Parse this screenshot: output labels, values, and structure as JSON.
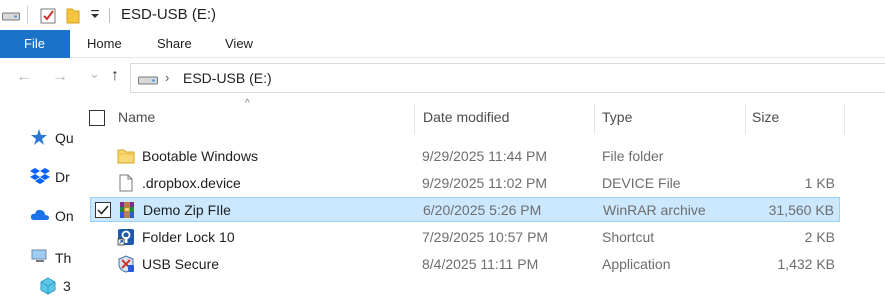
{
  "window": {
    "title": "ESD-USB (E:)",
    "quick_access_icons": [
      "drive-icon",
      "properties-check-icon",
      "new-folder-icon",
      "customize-dropdown-icon"
    ]
  },
  "ribbon": {
    "tabs": [
      {
        "label": "File",
        "active": true
      },
      {
        "label": "Home"
      },
      {
        "label": "Share"
      },
      {
        "label": "View"
      }
    ],
    "accent_color": "#1a73c8"
  },
  "nav": {
    "back_icon": "←",
    "forward_icon": "→",
    "recent_icon": "⌄",
    "up_icon": "↑",
    "breadcrumb": [
      "ESD-USB (E:)"
    ]
  },
  "left_pane": {
    "items": [
      {
        "label": "Qu",
        "icon": "star-icon"
      },
      {
        "label": "Dr",
        "icon": "dropbox-icon"
      },
      {
        "label": "On",
        "icon": "onedrive-icon"
      },
      {
        "label": "Th",
        "icon": "this-pc-icon"
      },
      {
        "label": "3",
        "icon": "3d-objects-icon"
      }
    ]
  },
  "columns": {
    "name": "Name",
    "date": "Date modified",
    "type": "Type",
    "size": "Size",
    "sort_indicator": "^"
  },
  "files": [
    {
      "name": "Bootable Windows",
      "date": "9/29/2025 11:44 PM",
      "type": "File folder",
      "size": "",
      "icon": "folder-icon",
      "selected": false
    },
    {
      "name": ".dropbox.device",
      "date": "9/29/2025 11:02 PM",
      "type": "DEVICE File",
      "size": "1 KB",
      "icon": "file-icon",
      "selected": false
    },
    {
      "name": "Demo Zip FIle",
      "date": "6/20/2025 5:26 PM",
      "type": "WinRAR archive",
      "size": "31,560 KB",
      "icon": "winrar-icon",
      "selected": true
    },
    {
      "name": "Folder Lock 10",
      "date": "7/29/2025 10:57 PM",
      "type": "Shortcut",
      "size": "2 KB",
      "icon": "folder-lock-icon",
      "selected": false
    },
    {
      "name": "USB Secure",
      "date": "8/4/2025 11:11 PM",
      "type": "Application",
      "size": "1,432 KB",
      "icon": "usb-secure-icon",
      "selected": false
    }
  ]
}
